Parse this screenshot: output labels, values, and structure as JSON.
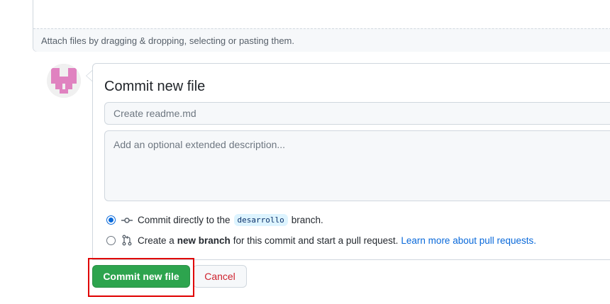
{
  "attach": {
    "text": "Attach files by dragging & dropping, selecting or pasting them."
  },
  "avatar": {
    "icon": "identicon-avatar",
    "color": "#e082c0"
  },
  "commit": {
    "title": "Commit new file",
    "summary_placeholder": "Create readme.md",
    "description_placeholder": "Add an optional extended description...",
    "option_direct": {
      "prefix": "Commit directly to the",
      "branch": "desarrollo",
      "suffix": "branch.",
      "selected": true,
      "icon": "git-commit-icon"
    },
    "option_new_branch": {
      "prefix": "Create a",
      "bold": "new branch",
      "middle": "for this commit and start a pull request.",
      "link": "Learn more about pull requests.",
      "selected": false,
      "icon": "git-pull-request-icon"
    }
  },
  "buttons": {
    "commit_label": "Commit new file",
    "cancel_label": "Cancel"
  },
  "colors": {
    "primary": "#2da44e",
    "link": "#0969da",
    "danger": "#cf222e",
    "highlight": "#e00000"
  }
}
